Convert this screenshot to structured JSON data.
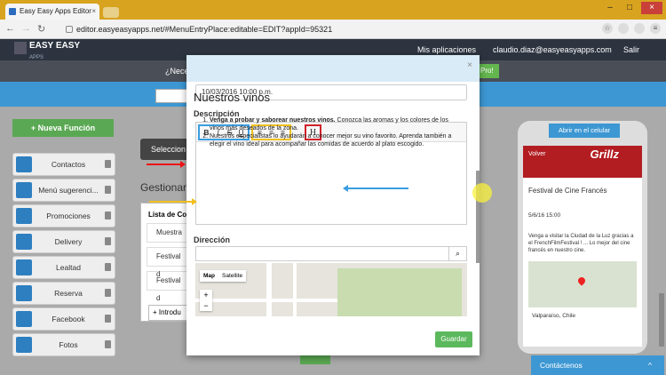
{
  "browser": {
    "tab_title": "Easy Easy Apps Editor",
    "url": "editor.easyeasyapps.net/#MenuEntryPlace:editable=EDIT?appId=95321",
    "tab_close": "×"
  },
  "header": {
    "logo_text": "EASY EASY",
    "logo_sub": "APPS",
    "my_apps": "Mis aplicaciones",
    "user_email": "claudio.diaz@easyeasyapps.com",
    "logout": "Salir"
  },
  "promo": {
    "text": "¿Nece",
    "button": "Pro!"
  },
  "sidebar": {
    "new_function": "+ Nueva Función",
    "items": [
      {
        "label": "Contactos",
        "icon": "home-icon"
      },
      {
        "label": "Menú sugerenci...",
        "icon": "book-icon"
      },
      {
        "label": "Promociones",
        "icon": "dollar-icon"
      },
      {
        "label": "Delivery",
        "icon": "truck-icon"
      },
      {
        "label": "Lealtad",
        "icon": "heart-icon"
      },
      {
        "label": "Reserva",
        "icon": "calendar-icon"
      },
      {
        "label": "Facebook",
        "icon": "share-icon"
      },
      {
        "label": "Fotos",
        "icon": "photo-icon"
      }
    ]
  },
  "main": {
    "select_label": "Seleccion",
    "gestion": "Gestionar",
    "list_header": "Lista de Co",
    "rows": [
      "Muestra",
      "Festival d",
      "Festival d"
    ],
    "intro_button": "+ Introdu"
  },
  "modal": {
    "close": "×",
    "date_value": "10/03/2016 10:00 p.m.",
    "description_label": "Descripción",
    "toolbar": {
      "bold": "B",
      "italic": "I",
      "strike": "S",
      "underline": "U",
      "bullet_list": "≡",
      "ordered_list": "≡",
      "align": "≡",
      "heading": "H"
    },
    "editor_heading": "Nuestros vinos",
    "editor_list": [
      {
        "bold": "Venga a probar y saborear nuestros vinos.",
        "rest": " Conozca las aromas y los colores de los vinos más deseados de la zona."
      },
      {
        "bold": "",
        "rest": "Nuestros especialistas lo ayudarán a conocer mejor su vino favorito. Aprenda también a elegir el vino ideal para acompañar las comidas de acuerdo al plato escogido."
      }
    ],
    "direccion_label": "Dirección",
    "direccion_value": "",
    "map_tab_map": "Map",
    "map_tab_satellite": "Satellite",
    "zoom_in": "+",
    "zoom_out": "−",
    "save_button": "Guardar"
  },
  "phone": {
    "button": "Abrir en el celular",
    "banner_back": "Volver",
    "banner_logo": "Grillz",
    "title": "Festival de Cine Francés",
    "date": "5/6/16 15:00",
    "text": "Venga a visitar la Ciudad de la Luz gracias a el FrenchFilmFestival ! ... Lo mejor del cine francés en nuestro cine.",
    "location": "Valparaíso, Chile"
  },
  "contact_bar": {
    "label": "Contáctenos",
    "chevron": "^"
  },
  "colors": {
    "header_bg": "#2d3440",
    "accent_blue": "#3d97d3",
    "green": "#5cb85c",
    "bold_group_border": "#3a9ee0",
    "list_group_border": "#f0c020",
    "heading_group_border": "#d0202a"
  }
}
